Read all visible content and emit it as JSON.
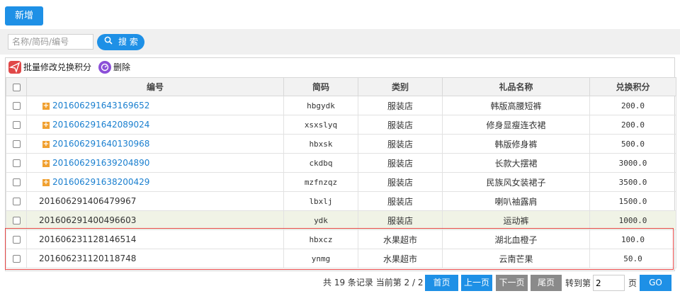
{
  "toolbar_top": {
    "add_label": "新增"
  },
  "search": {
    "placeholder": "名称/简码/编号",
    "button_label": "搜 索"
  },
  "grid_toolbar": {
    "batch_label": "批量修改兑换积分",
    "delete_label": "删除"
  },
  "columns": [
    "编号",
    "简码",
    "类别",
    "礼品名称",
    "兑换积分"
  ],
  "rows": [
    {
      "id": "201606291643169652",
      "code": "hbgydk",
      "category": "服装店",
      "name": "韩版高腰短裤",
      "points": "200.0",
      "expandable": true
    },
    {
      "id": "201606291642089024",
      "code": "xsxslyq",
      "category": "服装店",
      "name": "修身显瘦连衣裙",
      "points": "200.0",
      "expandable": true
    },
    {
      "id": "201606291640130968",
      "code": "hbxsk",
      "category": "服装店",
      "name": "韩版修身裤",
      "points": "500.0",
      "expandable": true
    },
    {
      "id": "201606291639204890",
      "code": "ckdbq",
      "category": "服装店",
      "name": "长款大摆裙",
      "points": "3000.0",
      "expandable": true
    },
    {
      "id": "201606291638200429",
      "code": "mzfnzqz",
      "category": "服装店",
      "name": "民族风女装裙子",
      "points": "3500.0",
      "expandable": true
    },
    {
      "id": "201606291406479967",
      "code": "lbxlj",
      "category": "服装店",
      "name": "喇叭袖露肩",
      "points": "1500.0",
      "expandable": false
    },
    {
      "id": "201606291400496603",
      "code": "ydk",
      "category": "服装店",
      "name": "运动裤",
      "points": "1000.0",
      "expandable": false
    },
    {
      "id": "201606231128146514",
      "code": "hbxcz",
      "category": "水果超市",
      "name": "湖北血橙子",
      "points": "100.0",
      "expandable": false
    },
    {
      "id": "201606231120118748",
      "code": "ynmg",
      "category": "水果超市",
      "name": "云南芒果",
      "points": "50.0",
      "expandable": false
    }
  ],
  "pager": {
    "info": "共 19 条记录 当前第 2 / 2 页",
    "first": "首页",
    "prev": "上一页",
    "next": "下一页",
    "last": "尾页",
    "goto_label": "转到第",
    "goto_value": "2",
    "suffix": "页",
    "go": "GO"
  }
}
